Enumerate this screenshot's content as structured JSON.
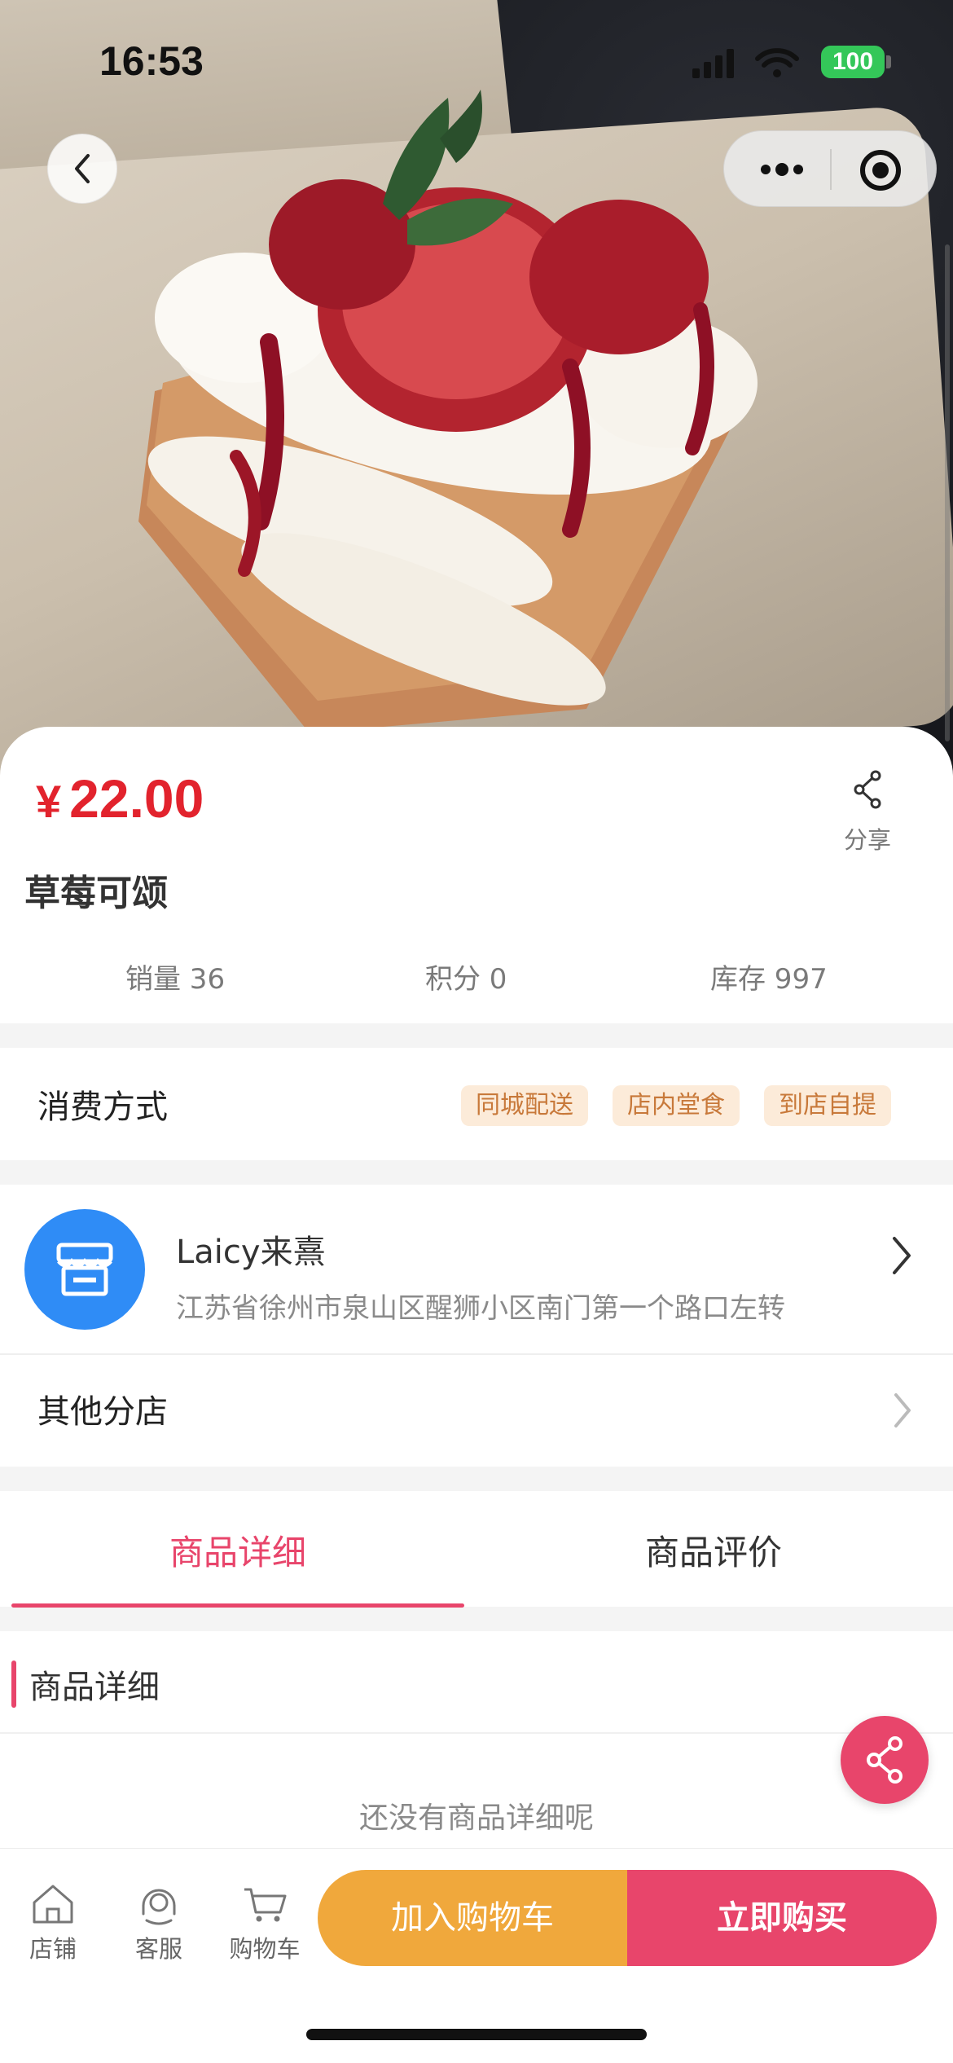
{
  "status_bar": {
    "time": "16:53",
    "battery": "100"
  },
  "product": {
    "currency_symbol": "¥",
    "price": "22.00",
    "name": "草莓可颂",
    "share_label": "分享",
    "stats": {
      "sales": "销量 36",
      "points": "积分 0",
      "stock": "库存 997"
    }
  },
  "consumption": {
    "label": "消费方式",
    "tags": [
      "同城配送",
      "店内堂食",
      "到店自提"
    ]
  },
  "shop": {
    "name": "Laicy来熹",
    "address": "江苏省徐州市泉山区醒狮小区南门第一个路口左转",
    "other_branches_label": "其他分店"
  },
  "tabs": {
    "details": "商品详细",
    "reviews": "商品评价"
  },
  "details": {
    "heading": "商品详细",
    "empty_text": "还没有商品详细呢"
  },
  "bottom_bar": {
    "store": "店铺",
    "service": "客服",
    "cart": "购物车",
    "add_to_cart": "加入购物车",
    "buy_now": "立即购买"
  },
  "colors": {
    "price_red": "#e2232d",
    "accent_pink": "#e8456b",
    "cart_orange": "#f0a83c",
    "shop_blue": "#2f8cf6",
    "tag_bg": "#fcebd9",
    "tag_text": "#c8793a"
  }
}
